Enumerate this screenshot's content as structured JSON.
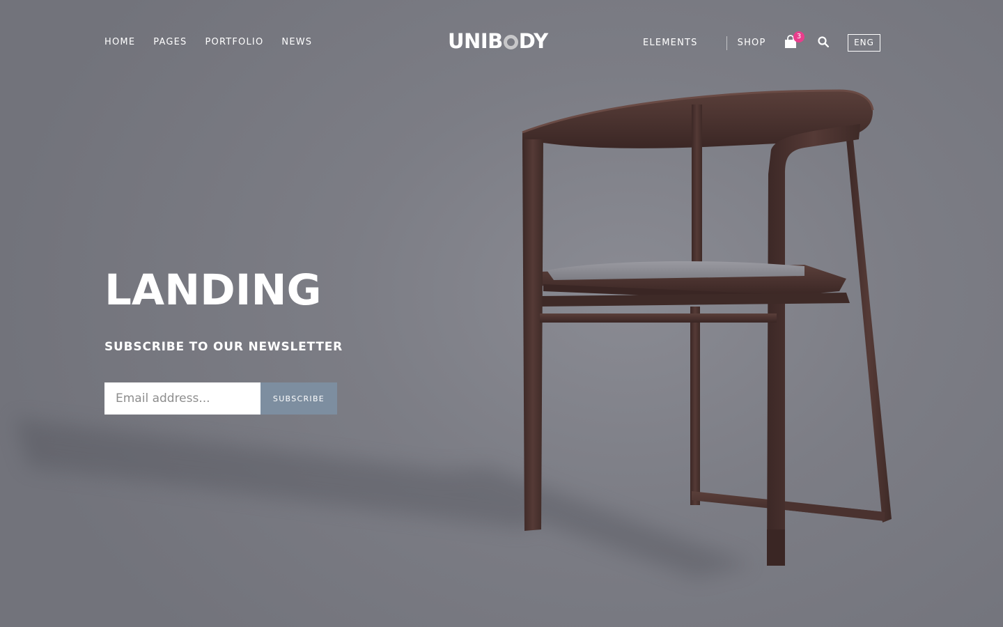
{
  "nav_left": [
    {
      "label": "HOME"
    },
    {
      "label": "PAGES"
    },
    {
      "label": "PORTFOLIO"
    },
    {
      "label": "NEWS"
    }
  ],
  "logo": {
    "before": "UNIB",
    "after": "DY"
  },
  "nav_right": [
    {
      "label": "ELEMENTS"
    },
    {
      "label": "SHOP"
    }
  ],
  "cart": {
    "count": "3",
    "icon": "shopping-bag-icon"
  },
  "search": {
    "icon": "search-icon"
  },
  "language": {
    "label": "ENG"
  },
  "hero": {
    "title": "LANDING",
    "subtitle": "SUBSCRIBE TO OUR NEWSLETTER",
    "email_placeholder": "Email address...",
    "email_value": "",
    "subscribe_label": "SUBSCRIBE"
  },
  "colors": {
    "background": "#7a7b83",
    "badge": "#e83e8c",
    "button": "#7d8ea0",
    "chair_wood": "#4a3330"
  }
}
